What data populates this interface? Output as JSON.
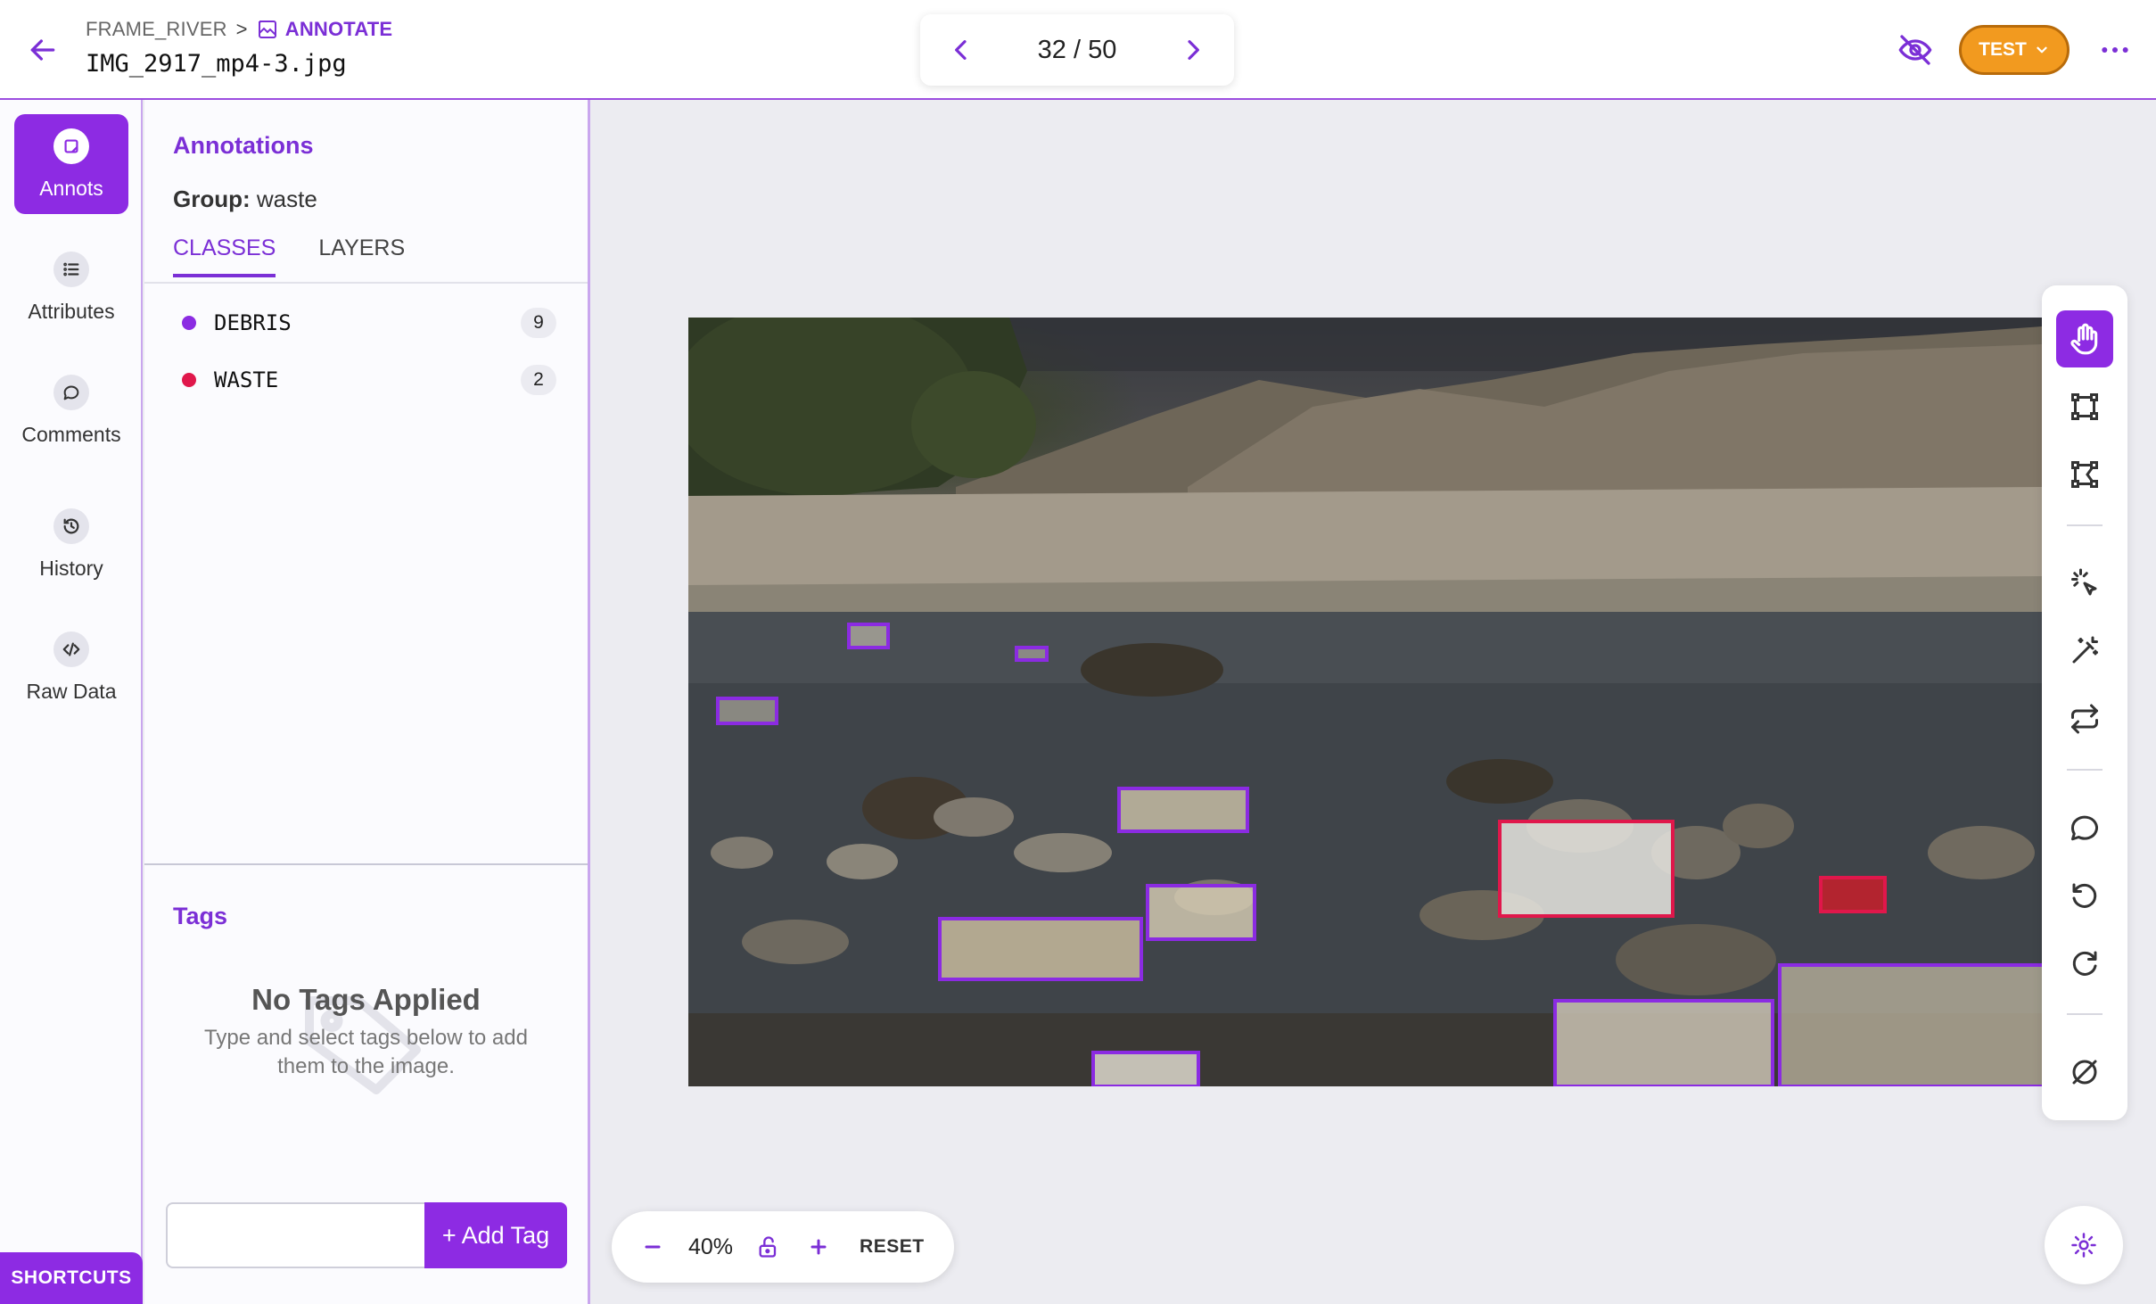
{
  "header": {
    "breadcrumb_project": "FRAME_RIVER",
    "breadcrumb_separator": ">",
    "breadcrumb_current": "ANNOTATE",
    "filename": "IMG_2917_mp4-3.jpg",
    "pager": "32 / 50",
    "test_label": "TEST"
  },
  "rail": {
    "items": [
      {
        "label": "Annots",
        "icon": "annotation-icon"
      },
      {
        "label": "Attributes",
        "icon": "list-icon"
      },
      {
        "label": "Comments",
        "icon": "comment-icon"
      },
      {
        "label": "History",
        "icon": "history-icon"
      },
      {
        "label": "Raw Data",
        "icon": "code-icon"
      }
    ],
    "shortcuts_label": "SHORTCUTS"
  },
  "panel": {
    "title": "Annotations",
    "group_label": "Group:",
    "group_value": "waste",
    "tabs": [
      "CLASSES",
      "LAYERS"
    ],
    "classes": [
      {
        "name": "DEBRIS",
        "count": "9",
        "color": "#8B2BE2"
      },
      {
        "name": "WASTE",
        "count": "2",
        "color": "#E0174B"
      }
    ],
    "tags_title": "Tags",
    "tags_empty_title": "No Tags Applied",
    "tags_empty_text": "Type and select tags below to add them to the image.",
    "tag_input_placeholder": "",
    "add_tag_label": "+ Add Tag"
  },
  "canvas": {
    "zoom_level": "40%",
    "reset_label": "RESET"
  },
  "colors": {
    "accent": "#8D2BE3",
    "debris": "#8B2BE2",
    "waste": "#E0174B",
    "test_button": "#F29A1F"
  }
}
